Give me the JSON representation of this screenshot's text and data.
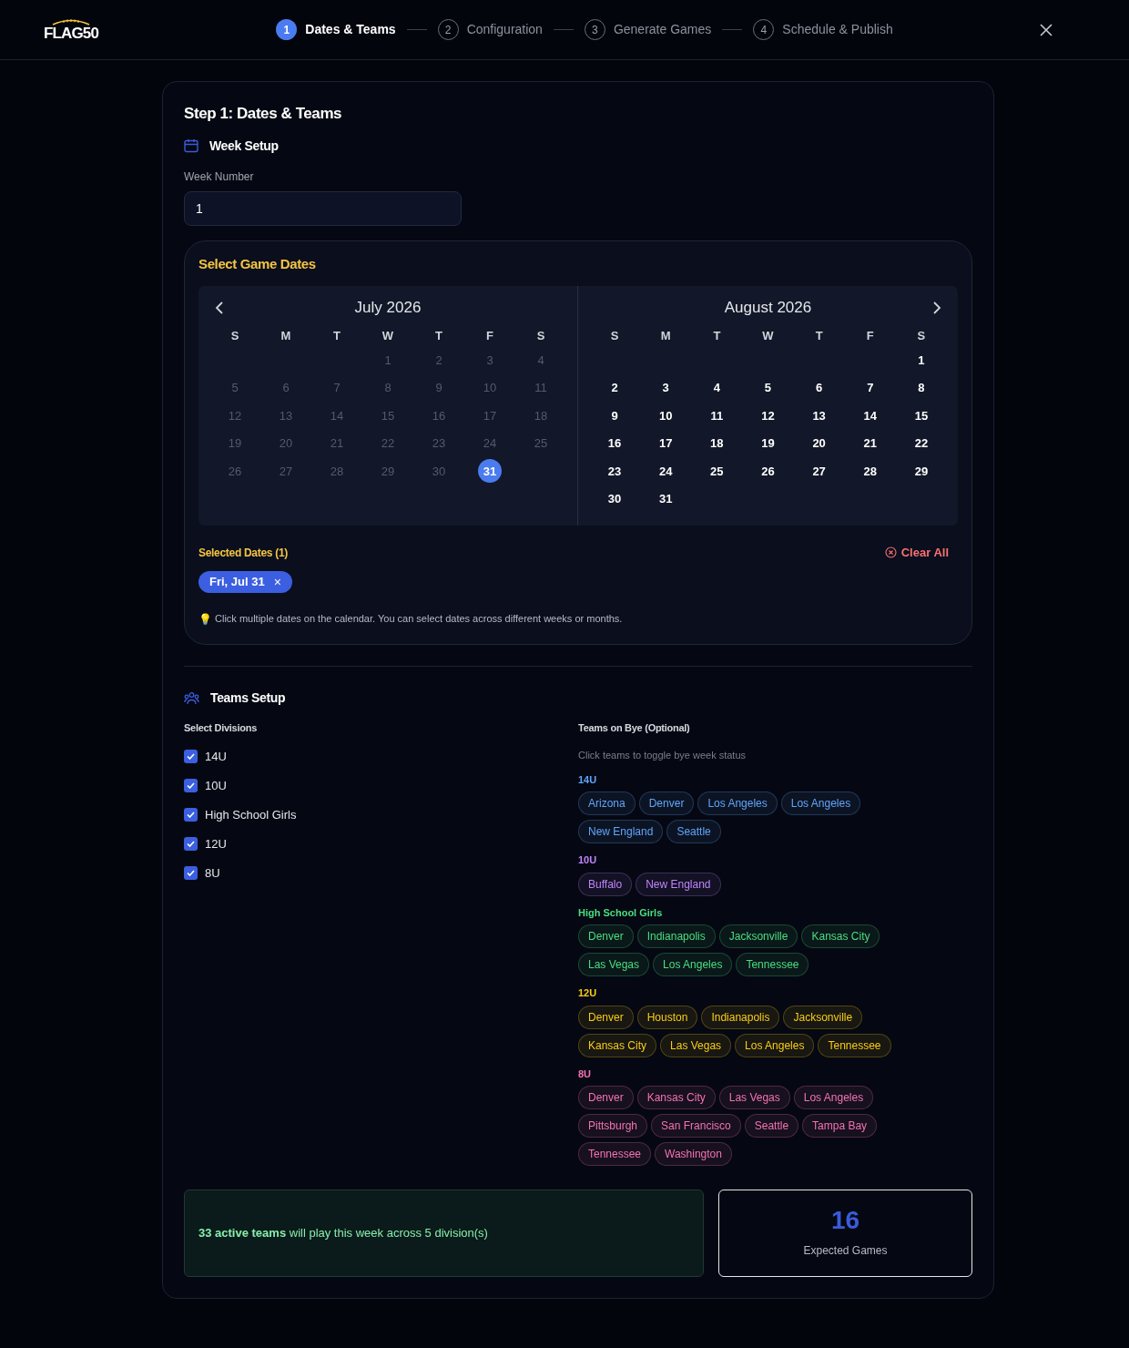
{
  "header": {
    "logo": "FLAG50",
    "steps": [
      {
        "number": "1",
        "label": "Dates & Teams",
        "selected": true
      },
      {
        "number": "2",
        "label": "Configuration",
        "selected": false
      },
      {
        "number": "3",
        "label": "Generate Games",
        "selected": false
      },
      {
        "number": "4",
        "label": "Schedule & Publish",
        "selected": false
      }
    ]
  },
  "step_title": "Step 1: Dates & Teams",
  "week_setup": {
    "title": "Week Setup",
    "field_label": "Week Number",
    "value": "1"
  },
  "game_dates": {
    "title": "Select Game Dates",
    "months": [
      {
        "title": "July 2026",
        "has_prev": true,
        "has_next": false,
        "weekdays": [
          "S",
          "M",
          "T",
          "W",
          "T",
          "F",
          "S"
        ],
        "weeks": [
          [
            {
              "kind": "blank"
            },
            {
              "kind": "blank"
            },
            {
              "kind": "blank"
            },
            {
              "kind": "day",
              "label": "1",
              "disabled": true,
              "selected": false
            },
            {
              "kind": "day",
              "label": "2",
              "disabled": true,
              "selected": false
            },
            {
              "kind": "day",
              "label": "3",
              "disabled": true,
              "selected": false
            },
            {
              "kind": "day",
              "label": "4",
              "disabled": true,
              "selected": false
            }
          ],
          [
            {
              "kind": "day",
              "label": "5",
              "disabled": true,
              "selected": false
            },
            {
              "kind": "day",
              "label": "6",
              "disabled": true,
              "selected": false
            },
            {
              "kind": "day",
              "label": "7",
              "disabled": true,
              "selected": false
            },
            {
              "kind": "day",
              "label": "8",
              "disabled": true,
              "selected": false
            },
            {
              "kind": "day",
              "label": "9",
              "disabled": true,
              "selected": false
            },
            {
              "kind": "day",
              "label": "10",
              "disabled": true,
              "selected": false
            },
            {
              "kind": "day",
              "label": "11",
              "disabled": true,
              "selected": false
            }
          ],
          [
            {
              "kind": "day",
              "label": "12",
              "disabled": true,
              "selected": false
            },
            {
              "kind": "day",
              "label": "13",
              "disabled": true,
              "selected": false
            },
            {
              "kind": "day",
              "label": "14",
              "disabled": true,
              "selected": false
            },
            {
              "kind": "day",
              "label": "15",
              "disabled": true,
              "selected": false
            },
            {
              "kind": "day",
              "label": "16",
              "disabled": true,
              "selected": false
            },
            {
              "kind": "day",
              "label": "17",
              "disabled": true,
              "selected": false
            },
            {
              "kind": "day",
              "label": "18",
              "disabled": true,
              "selected": false
            }
          ],
          [
            {
              "kind": "day",
              "label": "19",
              "disabled": true,
              "selected": false
            },
            {
              "kind": "day",
              "label": "20",
              "disabled": true,
              "selected": false
            },
            {
              "kind": "day",
              "label": "21",
              "disabled": true,
              "selected": false
            },
            {
              "kind": "day",
              "label": "22",
              "disabled": true,
              "selected": false
            },
            {
              "kind": "day",
              "label": "23",
              "disabled": true,
              "selected": false
            },
            {
              "kind": "day",
              "label": "24",
              "disabled": true,
              "selected": false
            },
            {
              "kind": "day",
              "label": "25",
              "disabled": true,
              "selected": false
            }
          ],
          [
            {
              "kind": "day",
              "label": "26",
              "disabled": true,
              "selected": false
            },
            {
              "kind": "day",
              "label": "27",
              "disabled": true,
              "selected": false
            },
            {
              "kind": "day",
              "label": "28",
              "disabled": true,
              "selected": false
            },
            {
              "kind": "day",
              "label": "29",
              "disabled": true,
              "selected": false
            },
            {
              "kind": "day",
              "label": "30",
              "disabled": true,
              "selected": false
            },
            {
              "kind": "day",
              "label": "31",
              "disabled": false,
              "selected": true
            },
            {
              "kind": "blank"
            }
          ]
        ]
      },
      {
        "title": "August 2026",
        "has_prev": false,
        "has_next": true,
        "weekdays": [
          "S",
          "M",
          "T",
          "W",
          "T",
          "F",
          "S"
        ],
        "weeks": [
          [
            {
              "kind": "blank"
            },
            {
              "kind": "blank"
            },
            {
              "kind": "blank"
            },
            {
              "kind": "blank"
            },
            {
              "kind": "blank"
            },
            {
              "kind": "blank"
            },
            {
              "kind": "day",
              "label": "1",
              "disabled": false,
              "selected": false
            }
          ],
          [
            {
              "kind": "day",
              "label": "2",
              "disabled": false,
              "selected": false
            },
            {
              "kind": "day",
              "label": "3",
              "disabled": false,
              "selected": false
            },
            {
              "kind": "day",
              "label": "4",
              "disabled": false,
              "selected": false
            },
            {
              "kind": "day",
              "label": "5",
              "disabled": false,
              "selected": false
            },
            {
              "kind": "day",
              "label": "6",
              "disabled": false,
              "selected": false
            },
            {
              "kind": "day",
              "label": "7",
              "disabled": false,
              "selected": false
            },
            {
              "kind": "day",
              "label": "8",
              "disabled": false,
              "selected": false
            }
          ],
          [
            {
              "kind": "day",
              "label": "9",
              "disabled": false,
              "selected": false
            },
            {
              "kind": "day",
              "label": "10",
              "disabled": false,
              "selected": false
            },
            {
              "kind": "day",
              "label": "11",
              "disabled": false,
              "selected": false
            },
            {
              "kind": "day",
              "label": "12",
              "disabled": false,
              "selected": false
            },
            {
              "kind": "day",
              "label": "13",
              "disabled": false,
              "selected": false
            },
            {
              "kind": "day",
              "label": "14",
              "disabled": false,
              "selected": false
            },
            {
              "kind": "day",
              "label": "15",
              "disabled": false,
              "selected": false
            }
          ],
          [
            {
              "kind": "day",
              "label": "16",
              "disabled": false,
              "selected": false
            },
            {
              "kind": "day",
              "label": "17",
              "disabled": false,
              "selected": false
            },
            {
              "kind": "day",
              "label": "18",
              "disabled": false,
              "selected": false
            },
            {
              "kind": "day",
              "label": "19",
              "disabled": false,
              "selected": false
            },
            {
              "kind": "day",
              "label": "20",
              "disabled": false,
              "selected": false
            },
            {
              "kind": "day",
              "label": "21",
              "disabled": false,
              "selected": false
            },
            {
              "kind": "day",
              "label": "22",
              "disabled": false,
              "selected": false
            }
          ],
          [
            {
              "kind": "day",
              "label": "23",
              "disabled": false,
              "selected": false
            },
            {
              "kind": "day",
              "label": "24",
              "disabled": false,
              "selected": false
            },
            {
              "kind": "day",
              "label": "25",
              "disabled": false,
              "selected": false
            },
            {
              "kind": "day",
              "label": "26",
              "disabled": false,
              "selected": false
            },
            {
              "kind": "day",
              "label": "27",
              "disabled": false,
              "selected": false
            },
            {
              "kind": "day",
              "label": "28",
              "disabled": false,
              "selected": false
            },
            {
              "kind": "day",
              "label": "29",
              "disabled": false,
              "selected": false
            }
          ],
          [
            {
              "kind": "day",
              "label": "30",
              "disabled": false,
              "selected": false
            },
            {
              "kind": "day",
              "label": "31",
              "disabled": false,
              "selected": false
            },
            {
              "kind": "blank"
            },
            {
              "kind": "blank"
            },
            {
              "kind": "blank"
            },
            {
              "kind": "blank"
            },
            {
              "kind": "blank"
            }
          ]
        ]
      }
    ],
    "selected_label": "Selected Dates (1)",
    "clear_all": "Clear All",
    "chips": [
      {
        "label": "Fri, Jul 31",
        "remove": "×"
      }
    ],
    "hint": "💡",
    "hint_text": "Click multiple dates on the calendar. You can select dates across different weeks or months."
  },
  "teams_setup": {
    "title": "Teams Setup",
    "divisions_label": "Select Divisions",
    "divisions": [
      {
        "label": "14U",
        "checked": true
      },
      {
        "label": "10U",
        "checked": true
      },
      {
        "label": "High School Girls",
        "checked": true
      },
      {
        "label": "12U",
        "checked": true
      },
      {
        "label": "8U",
        "checked": true
      }
    ],
    "bye_label": "Teams on Bye (Optional)",
    "bye_hint": "Click teams to toggle bye week status",
    "bye_groups": [
      {
        "division": "14U",
        "color": "#60a5fa",
        "teams": [
          "Arizona",
          "Denver",
          "Los Angeles",
          "Los Angeles",
          "New England",
          "Seattle"
        ]
      },
      {
        "division": "10U",
        "color": "#c084fc",
        "teams": [
          "Buffalo",
          "New England"
        ]
      },
      {
        "division": "High School Girls",
        "color": "#4ade80",
        "teams": [
          "Denver",
          "Indianapolis",
          "Jacksonville",
          "Kansas City",
          "Las Vegas",
          "Los Angeles",
          "Tennessee"
        ]
      },
      {
        "division": "12U",
        "color": "#facc15",
        "teams": [
          "Denver",
          "Houston",
          "Indianapolis",
          "Jacksonville",
          "Kansas City",
          "Las Vegas",
          "Los Angeles",
          "Tennessee"
        ]
      },
      {
        "division": "8U",
        "color": "#f472b6",
        "teams": [
          "Denver",
          "Kansas City",
          "Las Vegas",
          "Los Angeles",
          "Pittsburgh",
          "San Francisco",
          "Seattle",
          "Tampa Bay",
          "Tennessee",
          "Washington"
        ]
      }
    ]
  },
  "summary": {
    "text": "**33 active teams** will play this week across 5 division(s)",
    "expected_value": "16",
    "expected_label": "Expected Games"
  }
}
